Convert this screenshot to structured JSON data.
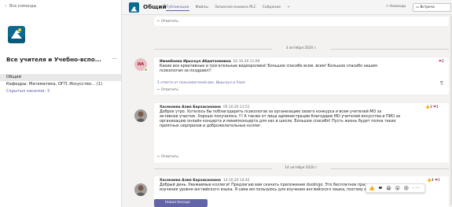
{
  "sidebar": {
    "back_label": "Все команды",
    "team_name": "Все учителя и Учебно-вспо...",
    "more": "···",
    "channels": [
      {
        "label": "Общий"
      },
      {
        "label": "Кафедры: Математика, ОГП, Искусство... (1)"
      },
      {
        "label": "Скрытых каналов: 3"
      }
    ]
  },
  "topbar": {
    "channel": "Общий",
    "tabs": [
      "Публикации",
      "Файлы",
      "Записная книжка PLC",
      "Собрание",
      "+"
    ],
    "team_button": "Команда",
    "meet_button": "Встреча"
  },
  "feed": {
    "reply_label": "Ответить",
    "date1": "3 октября 2020 г.",
    "date2": "14 октября 2020 г.",
    "msg1": {
      "initials": "ИА",
      "author": "Имамбаева Ирыскул Абдиталиевна",
      "time": "02.10.20 11:09",
      "text": "Какие все креативные и трогательные видеоролики! Большое спасибо всем, всем! Большое спасибо нашим\nпсихологам за поздравл!!",
      "hearts": "2",
      "reply_link": "2 ответа от пользователей вас, Ирыскул и Алия"
    },
    "msg2": {
      "author": "Хасенаева Алия Барзакановна",
      "time": "05.10.20 11:51",
      "text": "Доброе утро. Хотелось бы поблагодарить психологов за организацию своего конкурса и всем учителей МО за\nактивное участие. Хорошо получилось !!! А также от лица администрации благодарю МО учителей искусства и ПИО за\nорганизацию онлайн концерта и минипконцерта для нас в школе. Большое спасибо! Пусть жизнь будет полна таких\nприятных сюрпризов и доброжелательных коллег.",
      "likes": "3",
      "hearts": "1"
    },
    "msg3": {
      "author": "Хасенаева Алия Барзакановна",
      "time": "14.10.20 14:42",
      "text": "Добрый день. Уважаемые коллеги! Предлагаю вам скачать приложение duolingo. Это бесплатное приложение для\nизучения уровня английского языка. Я сама им пользуюсь для изучения английского языка, поэтому вам рекомендую.",
      "likes": "4",
      "hearts": "1"
    },
    "reaction_bar": "👍 ❤ 😆 😮 😢 ···",
    "new_conversation": "Новая беседа"
  },
  "colors": {
    "accent": "#6264a7",
    "heart": "#c4314b",
    "like": "#e3a32b"
  }
}
